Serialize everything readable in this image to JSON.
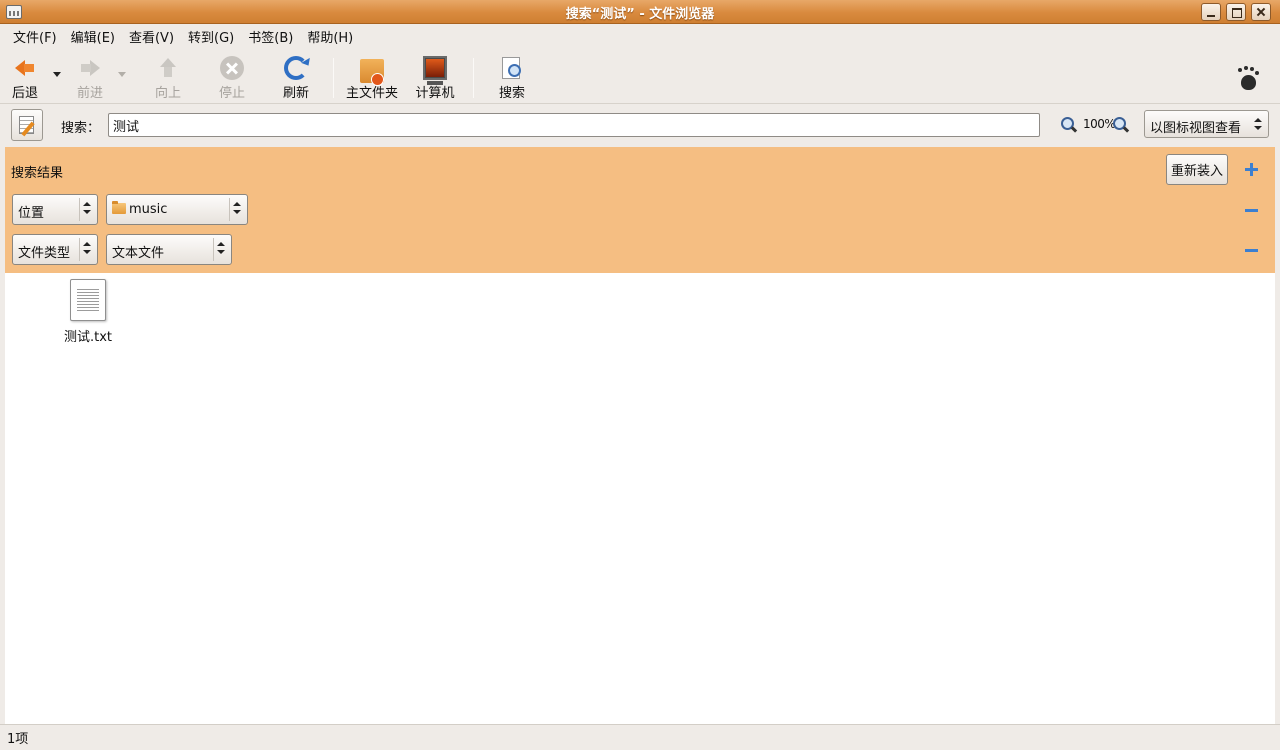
{
  "window": {
    "title": "搜索“测试” - 文件浏览器"
  },
  "menu": [
    "文件(F)",
    "编辑(E)",
    "查看(V)",
    "转到(G)",
    "书签(B)",
    "帮助(H)"
  ],
  "toolbar": {
    "back": "后退",
    "forward": "前进",
    "up": "向上",
    "stop": "停止",
    "reload": "刷新",
    "home": "主文件夹",
    "computer": "计算机",
    "search": "搜索"
  },
  "search": {
    "label": "搜索：",
    "value": "测试",
    "zoom": "100%",
    "view_mode": "以图标视图查看"
  },
  "query": {
    "title": "搜索结果",
    "reload_label": "重新装入",
    "rows": [
      {
        "type": "位置",
        "value": "music"
      },
      {
        "type": "文件类型",
        "value": "文本文件"
      }
    ]
  },
  "files": [
    {
      "name": "测试.txt"
    }
  ],
  "status": {
    "text": "1项"
  },
  "colors": {
    "titlebar": "#d98a3e",
    "query_panel": "#f5be82",
    "accent_blue": "#3c7fd0"
  }
}
